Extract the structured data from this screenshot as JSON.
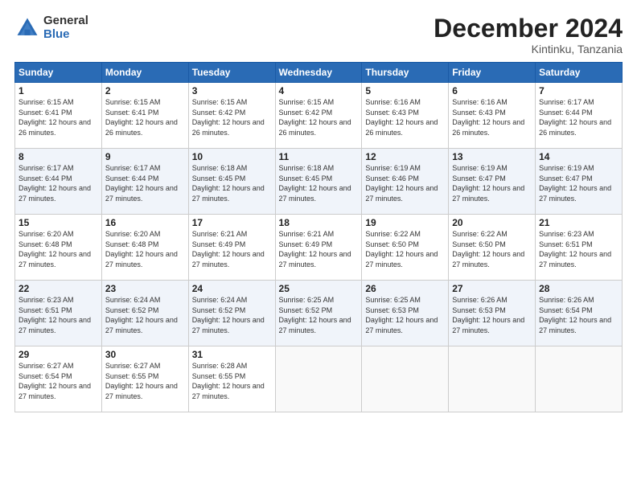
{
  "logo": {
    "general": "General",
    "blue": "Blue"
  },
  "title": {
    "month": "December 2024",
    "location": "Kintinku, Tanzania"
  },
  "headers": [
    "Sunday",
    "Monday",
    "Tuesday",
    "Wednesday",
    "Thursday",
    "Friday",
    "Saturday"
  ],
  "weeks": [
    [
      {
        "day": "1",
        "sunrise": "6:15 AM",
        "sunset": "6:41 PM",
        "daylight": "12 hours and 26 minutes."
      },
      {
        "day": "2",
        "sunrise": "6:15 AM",
        "sunset": "6:41 PM",
        "daylight": "12 hours and 26 minutes."
      },
      {
        "day": "3",
        "sunrise": "6:15 AM",
        "sunset": "6:42 PM",
        "daylight": "12 hours and 26 minutes."
      },
      {
        "day": "4",
        "sunrise": "6:15 AM",
        "sunset": "6:42 PM",
        "daylight": "12 hours and 26 minutes."
      },
      {
        "day": "5",
        "sunrise": "6:16 AM",
        "sunset": "6:43 PM",
        "daylight": "12 hours and 26 minutes."
      },
      {
        "day": "6",
        "sunrise": "6:16 AM",
        "sunset": "6:43 PM",
        "daylight": "12 hours and 26 minutes."
      },
      {
        "day": "7",
        "sunrise": "6:17 AM",
        "sunset": "6:44 PM",
        "daylight": "12 hours and 26 minutes."
      }
    ],
    [
      {
        "day": "8",
        "sunrise": "6:17 AM",
        "sunset": "6:44 PM",
        "daylight": "12 hours and 27 minutes."
      },
      {
        "day": "9",
        "sunrise": "6:17 AM",
        "sunset": "6:44 PM",
        "daylight": "12 hours and 27 minutes."
      },
      {
        "day": "10",
        "sunrise": "6:18 AM",
        "sunset": "6:45 PM",
        "daylight": "12 hours and 27 minutes."
      },
      {
        "day": "11",
        "sunrise": "6:18 AM",
        "sunset": "6:45 PM",
        "daylight": "12 hours and 27 minutes."
      },
      {
        "day": "12",
        "sunrise": "6:19 AM",
        "sunset": "6:46 PM",
        "daylight": "12 hours and 27 minutes."
      },
      {
        "day": "13",
        "sunrise": "6:19 AM",
        "sunset": "6:47 PM",
        "daylight": "12 hours and 27 minutes."
      },
      {
        "day": "14",
        "sunrise": "6:19 AM",
        "sunset": "6:47 PM",
        "daylight": "12 hours and 27 minutes."
      }
    ],
    [
      {
        "day": "15",
        "sunrise": "6:20 AM",
        "sunset": "6:48 PM",
        "daylight": "12 hours and 27 minutes."
      },
      {
        "day": "16",
        "sunrise": "6:20 AM",
        "sunset": "6:48 PM",
        "daylight": "12 hours and 27 minutes."
      },
      {
        "day": "17",
        "sunrise": "6:21 AM",
        "sunset": "6:49 PM",
        "daylight": "12 hours and 27 minutes."
      },
      {
        "day": "18",
        "sunrise": "6:21 AM",
        "sunset": "6:49 PM",
        "daylight": "12 hours and 27 minutes."
      },
      {
        "day": "19",
        "sunrise": "6:22 AM",
        "sunset": "6:50 PM",
        "daylight": "12 hours and 27 minutes."
      },
      {
        "day": "20",
        "sunrise": "6:22 AM",
        "sunset": "6:50 PM",
        "daylight": "12 hours and 27 minutes."
      },
      {
        "day": "21",
        "sunrise": "6:23 AM",
        "sunset": "6:51 PM",
        "daylight": "12 hours and 27 minutes."
      }
    ],
    [
      {
        "day": "22",
        "sunrise": "6:23 AM",
        "sunset": "6:51 PM",
        "daylight": "12 hours and 27 minutes."
      },
      {
        "day": "23",
        "sunrise": "6:24 AM",
        "sunset": "6:52 PM",
        "daylight": "12 hours and 27 minutes."
      },
      {
        "day": "24",
        "sunrise": "6:24 AM",
        "sunset": "6:52 PM",
        "daylight": "12 hours and 27 minutes."
      },
      {
        "day": "25",
        "sunrise": "6:25 AM",
        "sunset": "6:52 PM",
        "daylight": "12 hours and 27 minutes."
      },
      {
        "day": "26",
        "sunrise": "6:25 AM",
        "sunset": "6:53 PM",
        "daylight": "12 hours and 27 minutes."
      },
      {
        "day": "27",
        "sunrise": "6:26 AM",
        "sunset": "6:53 PM",
        "daylight": "12 hours and 27 minutes."
      },
      {
        "day": "28",
        "sunrise": "6:26 AM",
        "sunset": "6:54 PM",
        "daylight": "12 hours and 27 minutes."
      }
    ],
    [
      {
        "day": "29",
        "sunrise": "6:27 AM",
        "sunset": "6:54 PM",
        "daylight": "12 hours and 27 minutes."
      },
      {
        "day": "30",
        "sunrise": "6:27 AM",
        "sunset": "6:55 PM",
        "daylight": "12 hours and 27 minutes."
      },
      {
        "day": "31",
        "sunrise": "6:28 AM",
        "sunset": "6:55 PM",
        "daylight": "12 hours and 27 minutes."
      },
      null,
      null,
      null,
      null
    ]
  ]
}
